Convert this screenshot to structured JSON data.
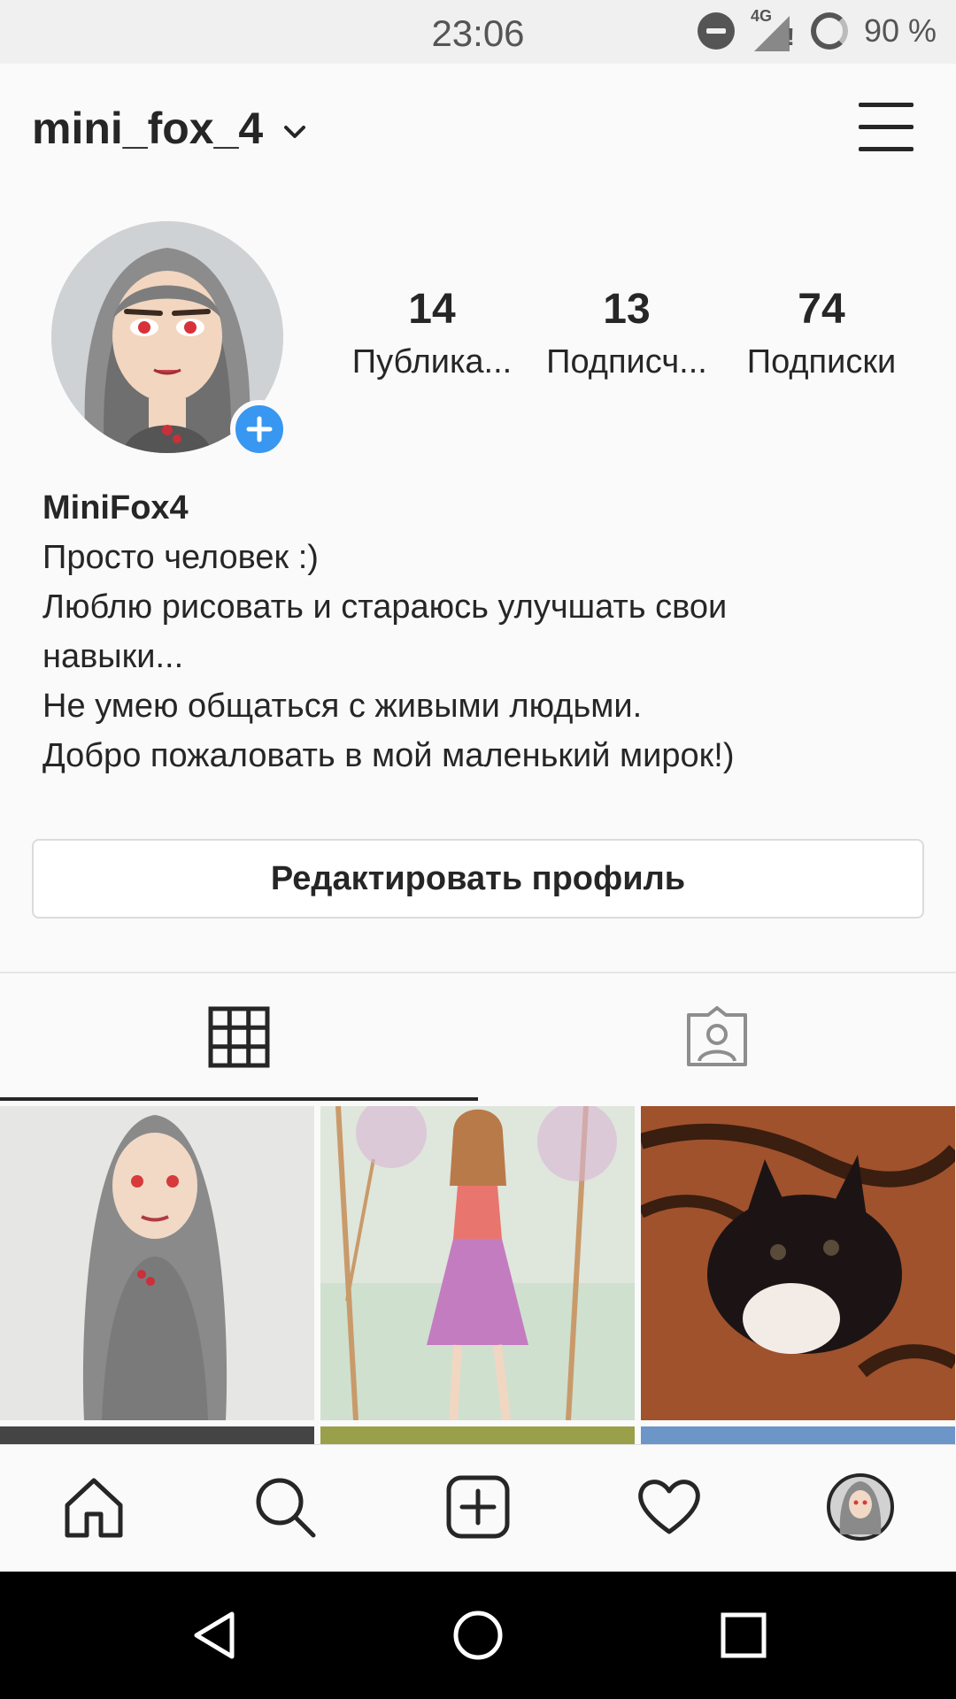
{
  "status_bar": {
    "time": "23:06",
    "network_label": "4G",
    "battery_percent": "90 %",
    "icons": [
      "do-not-disturb-icon",
      "signal-icon",
      "battery-icon"
    ]
  },
  "header": {
    "username": "mini_fox_4",
    "icons": [
      "chevron-down-icon",
      "menu-icon"
    ]
  },
  "profile": {
    "stats": [
      {
        "value": "14",
        "label": "Публика..."
      },
      {
        "value": "13",
        "label": "Подписч..."
      },
      {
        "value": "74",
        "label": "Подписки"
      }
    ],
    "display_name": "MiniFox4",
    "bio_lines": [
      "Просто человек :)",
      "Люблю рисовать и стараюсь улучшать свои",
      "навыки...",
      "Не умею общаться с живыми людьми.",
      "Добро пожаловать в мой маленький мирок!)"
    ],
    "edit_button": "Редактировать профиль"
  },
  "tabs": [
    {
      "name": "grid-icon",
      "active": true
    },
    {
      "name": "tagged-icon",
      "active": false
    }
  ],
  "bottom_nav": [
    "home-icon",
    "search-icon",
    "add-post-icon",
    "activity-heart-icon",
    "profile-avatar-icon"
  ],
  "system_nav": [
    "back-icon",
    "home-circle-icon",
    "recents-icon"
  ],
  "colors": {
    "accent_blue": "#3897f0",
    "text": "#262626",
    "background": "#fafafa"
  }
}
